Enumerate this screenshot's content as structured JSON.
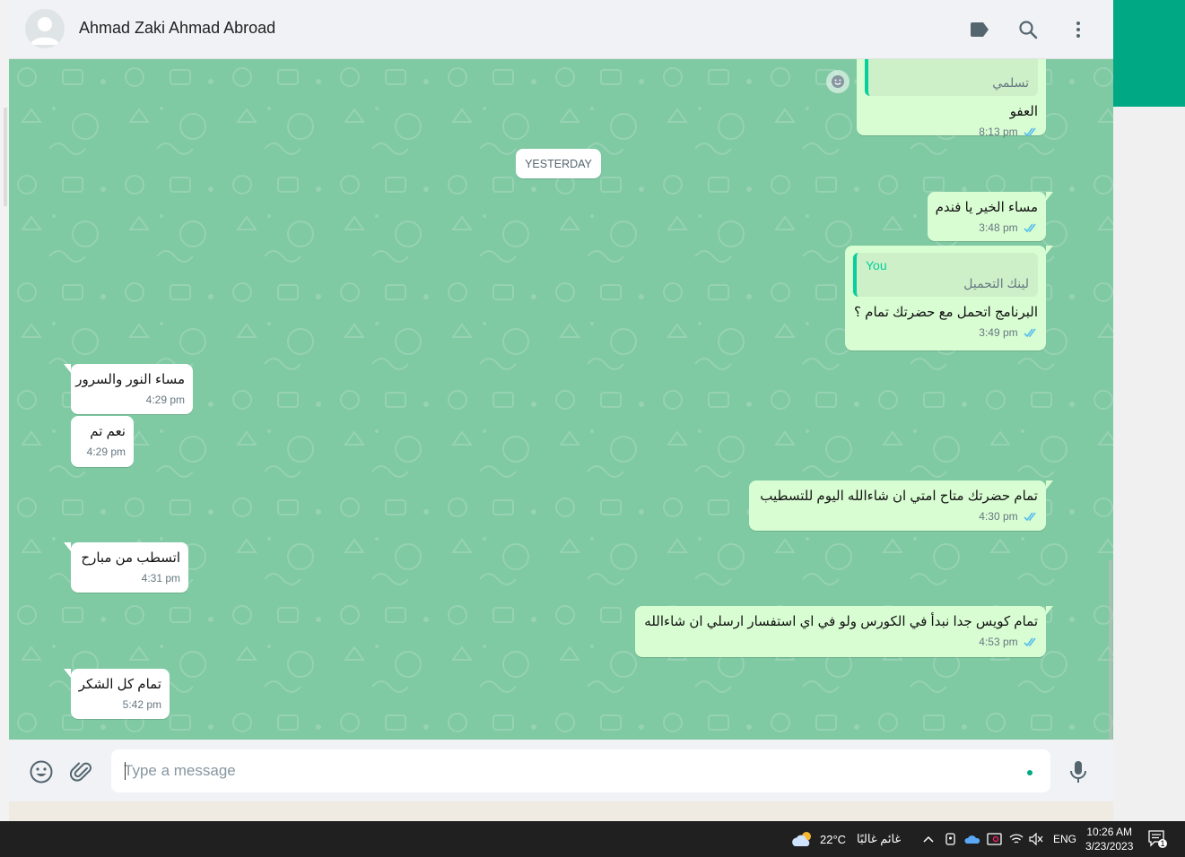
{
  "header": {
    "contact_name": "Ahmad Zaki Ahmad Abroad",
    "icons": [
      "label-icon",
      "search-icon",
      "more-options-icon"
    ]
  },
  "chat": {
    "date_divider": "YESTERDAY",
    "messages": [
      {
        "direction": "outgoing",
        "quote_text": "تسلمي",
        "text": "العفو",
        "time": "8:13 pm",
        "status": "read"
      },
      {
        "direction": "outgoing",
        "text": "مساء الخير يا فندم",
        "time": "3:48 pm",
        "status": "read"
      },
      {
        "direction": "outgoing",
        "quote_author": "You",
        "quote_text": "لينك التحميل",
        "text": "البرنامج اتحمل مع حضرتك تمام ؟",
        "time": "3:49 pm",
        "status": "read"
      },
      {
        "direction": "incoming",
        "text": "مساء النور والسرور",
        "time": "4:29 pm"
      },
      {
        "direction": "incoming",
        "text": "نعم تم",
        "time": "4:29 pm"
      },
      {
        "direction": "outgoing",
        "text": "تمام حضرتك متاح امتي ان شاءالله اليوم للتسطيب",
        "time": "4:30 pm",
        "status": "read"
      },
      {
        "direction": "incoming",
        "text": "اتسطب من مبارح",
        "time": "4:31 pm"
      },
      {
        "direction": "outgoing",
        "text": "تمام كويس جدا نبدأ في الكورس ولو في اي استفسار ارسلي ان شاءالله",
        "time": "4:53 pm",
        "status": "read"
      },
      {
        "direction": "incoming",
        "text": "تمام كل الشكر",
        "time": "5:42 pm"
      }
    ]
  },
  "compose": {
    "placeholder": "Type a message",
    "value": "",
    "icons": [
      "emoji-icon",
      "attach-icon",
      "microphone-icon"
    ]
  },
  "taskbar": {
    "weather_temp": "22°C",
    "weather_desc": "غائم غالبًا",
    "language": "ENG",
    "time": "10:26 AM",
    "date": "3/23/2023",
    "notification_count": "1"
  },
  "colors": {
    "chat_background": "#7fc9a3",
    "outgoing_bubble": "#d9fdd3",
    "incoming_bubble": "#ffffff",
    "accent": "#00a884",
    "read_tick": "#53bdeb",
    "taskbar": "#202020"
  }
}
